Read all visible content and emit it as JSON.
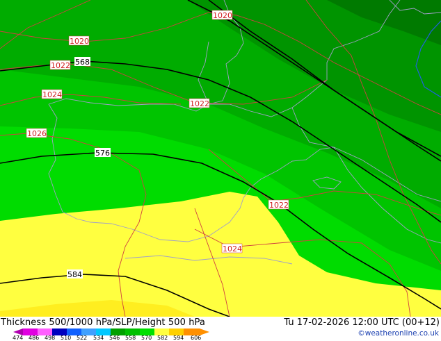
{
  "footer": {
    "title": "Thickness 500/1000 hPa/SLP/Height 500 hPa",
    "datetime": "Tu 17-02-2026 12:00 UTC (00+12)",
    "credit": "©weatheronline.co.uk"
  },
  "legend": {
    "ticks": [
      "474",
      "486",
      "498",
      "510",
      "522",
      "534",
      "546",
      "558",
      "570",
      "582",
      "594",
      "606"
    ],
    "colors": [
      "#b000b0",
      "#e000e0",
      "#ff60ff",
      "#0000c0",
      "#1060ff",
      "#40a0ff",
      "#00c8ff",
      "#00a000",
      "#00c000",
      "#00e000",
      "#ffff40",
      "#ffd000",
      "#ff9000"
    ]
  },
  "map": {
    "isobar_labels": [
      "1020",
      "1020",
      "1022",
      "1022",
      "1024",
      "1026",
      "1022",
      "1024"
    ],
    "height_labels": [
      "568",
      "576",
      "584"
    ],
    "colors": {
      "isobar": "#d04040",
      "height": "#000000",
      "coast": "#a0a0c8",
      "thickness_bands": [
        "#007a00",
        "#009400",
        "#00ac00",
        "#00c400",
        "#00dc00",
        "#ffff40",
        "#ffee20"
      ]
    }
  }
}
